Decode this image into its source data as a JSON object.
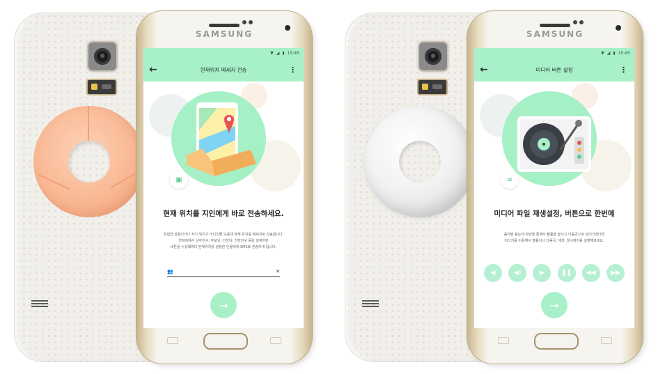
{
  "phone_brand": "SAMSUNG",
  "status_time": "15:45",
  "left_screen": {
    "title": "현재위치 메세지 전송",
    "headline": "현재 위치를 지인에게 바로 전송하세요.",
    "desc": [
      "위험한 상황이거나 자기 위치가 어디인줄 모를때 현재 위치를 메세지로 전송합니다.",
      "연락처에서 남자친구, 부모님, 선생님, 친한친구 등을 설정하면",
      "버튼을 누를때마다 현재위치를 설정한 인물에게 SMS로 전송하게 됩니다."
    ],
    "contact_placeholder": ""
  },
  "right_screen": {
    "title": "미디어 버튼 설정",
    "headline": "미디어 파일 재생설정, 버튼으로 한번에",
    "desc": [
      "음악을 듣는데 화면을 통해서 볼륨을 높이고 다음곡으로 넘어가셨다면",
      "버디키를 이용해서 볼륨이나 다음곡, 재생, 일시정지를 실행해보세요."
    ]
  },
  "icons": {
    "back": "arrow-left-icon",
    "more": "more-vertical-icon",
    "next": "arrow-right-icon"
  },
  "colors": {
    "accent": "#a8f0c8",
    "ring_peach": "#f9b894",
    "ring_white": "#f2f2f2"
  }
}
